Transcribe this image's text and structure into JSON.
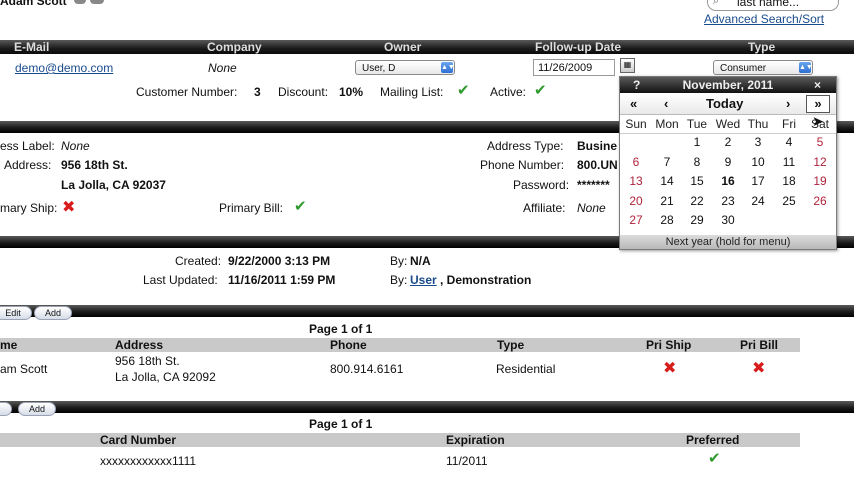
{
  "top": {
    "customer_name": "Adam Scott",
    "search_placeholder": "last name...",
    "advanced_search": "Advanced Search/Sort"
  },
  "contact_header": {
    "email": "E-Mail",
    "company": "Company",
    "owner": "Owner",
    "followup": "Follow-up Date",
    "type": "Type"
  },
  "contact": {
    "email": "demo@demo.com",
    "company": "None",
    "owner": "User, D",
    "followup": "11/26/2009",
    "type": "Consumer",
    "customer_number_label": "Customer Number:",
    "customer_number": "3",
    "discount_label": "Discount:",
    "discount": "10%",
    "mailing_label": "Mailing List:",
    "active_label": "Active:"
  },
  "address": {
    "label_label": "ess Label:",
    "label_value": "None",
    "address_label": "Address:",
    "line1": "956 18th St.",
    "line2": "La Jolla, CA 92037",
    "primary_ship_label": "mary Ship:",
    "primary_bill_label": "Primary Bill:",
    "type_label": "Address Type:",
    "type_value": "Busine",
    "phone_label": "Phone Number:",
    "phone_value": "800.UN",
    "password_label": "Password:",
    "password_value": "*******",
    "affiliate_label": "Affiliate:",
    "affiliate_value": "None"
  },
  "record": {
    "created_label": "Created:",
    "created": "9/22/2000 3:13 PM",
    "created_by_label": "By:",
    "created_by": "N/A",
    "updated_label": "Last Updated:",
    "updated": "11/16/2011 1:59 PM",
    "updated_by_label": "By:",
    "updated_by_link": "User",
    "updated_by_rest": ", Demonstration"
  },
  "addresses_grid": {
    "edit": "Edit",
    "add": "Add",
    "page": "Page 1 of 1",
    "headers": [
      "me",
      "Address",
      "Phone",
      "Type",
      "Pri Ship",
      "Pri Bill"
    ],
    "row": {
      "name": "am Scott",
      "addr1": "956 18th St.",
      "addr2": "La Jolla, CA 92092",
      "phone": "800.914.6161",
      "type": "Residential"
    }
  },
  "cards_grid": {
    "add": "Add",
    "page": "Page 1 of 1",
    "headers": [
      "Card Number",
      "Expiration",
      "Preferred"
    ],
    "row": {
      "card": "xxxxxxxxxxxx1111",
      "expiration": "11/2011"
    }
  },
  "calendar": {
    "help": "?",
    "title": "November, 2011",
    "close": "×",
    "prev_year": "«",
    "prev_month": "‹",
    "today": "Today",
    "next_month": "›",
    "next_year": "»",
    "weekdays": [
      "Sun",
      "Mon",
      "Tue",
      "Wed",
      "Thu",
      "Fri",
      "Sat"
    ],
    "weeks": [
      [
        "",
        "",
        "1",
        "2",
        "3",
        "4",
        "5"
      ],
      [
        "6",
        "7",
        "8",
        "9",
        "10",
        "11",
        "12"
      ],
      [
        "13",
        "14",
        "15",
        "16",
        "17",
        "18",
        "19"
      ],
      [
        "20",
        "21",
        "22",
        "23",
        "24",
        "25",
        "26"
      ],
      [
        "27",
        "28",
        "29",
        "30",
        "",
        "",
        ""
      ]
    ],
    "selected_day": "16",
    "footer": "Next year (hold for menu)"
  },
  "colors": {
    "check": "#2e9a2e",
    "cross": "#d81b1b",
    "weekend": "#b0223a",
    "link": "#1a4b8c"
  }
}
